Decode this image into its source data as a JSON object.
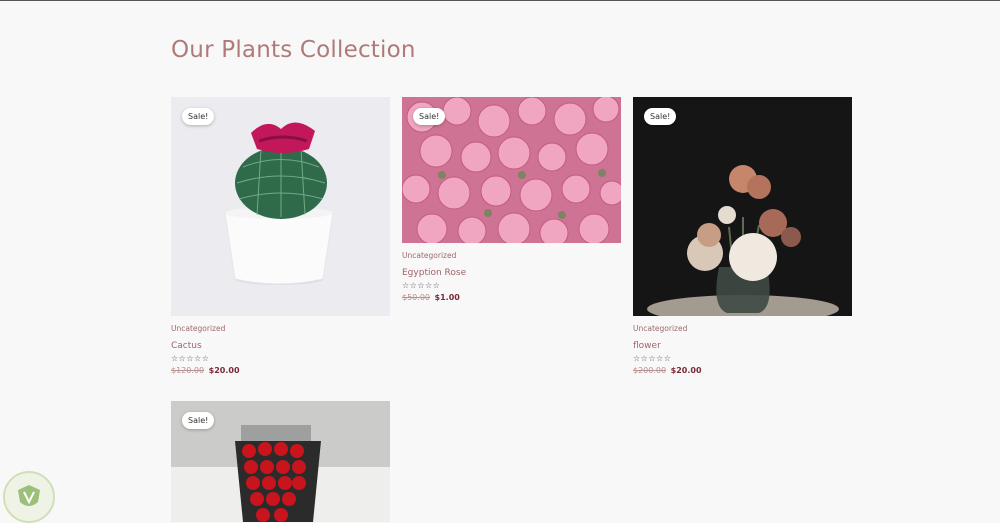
{
  "page": {
    "title": "Our Plants Collection"
  },
  "products": [
    {
      "sale": "Sale!",
      "category": "Uncategorized",
      "name": "Cactus",
      "rating": "0 of 5",
      "stars": "☆☆☆☆☆",
      "old_price": "$120.00",
      "new_price": "$20.00"
    },
    {
      "sale": "Sale!",
      "category": "Uncategorized",
      "name": "Egyption Rose",
      "rating": "0 of 5",
      "stars": "☆☆☆☆☆",
      "old_price": "$50.00",
      "new_price": "$1.00"
    },
    {
      "sale": "Sale!",
      "category": "Uncategorized",
      "name": "flower",
      "rating": "0 of 5",
      "stars": "☆☆☆☆☆",
      "old_price": "$200.00",
      "new_price": "$20.00"
    },
    {
      "sale": "Sale!"
    }
  ]
}
